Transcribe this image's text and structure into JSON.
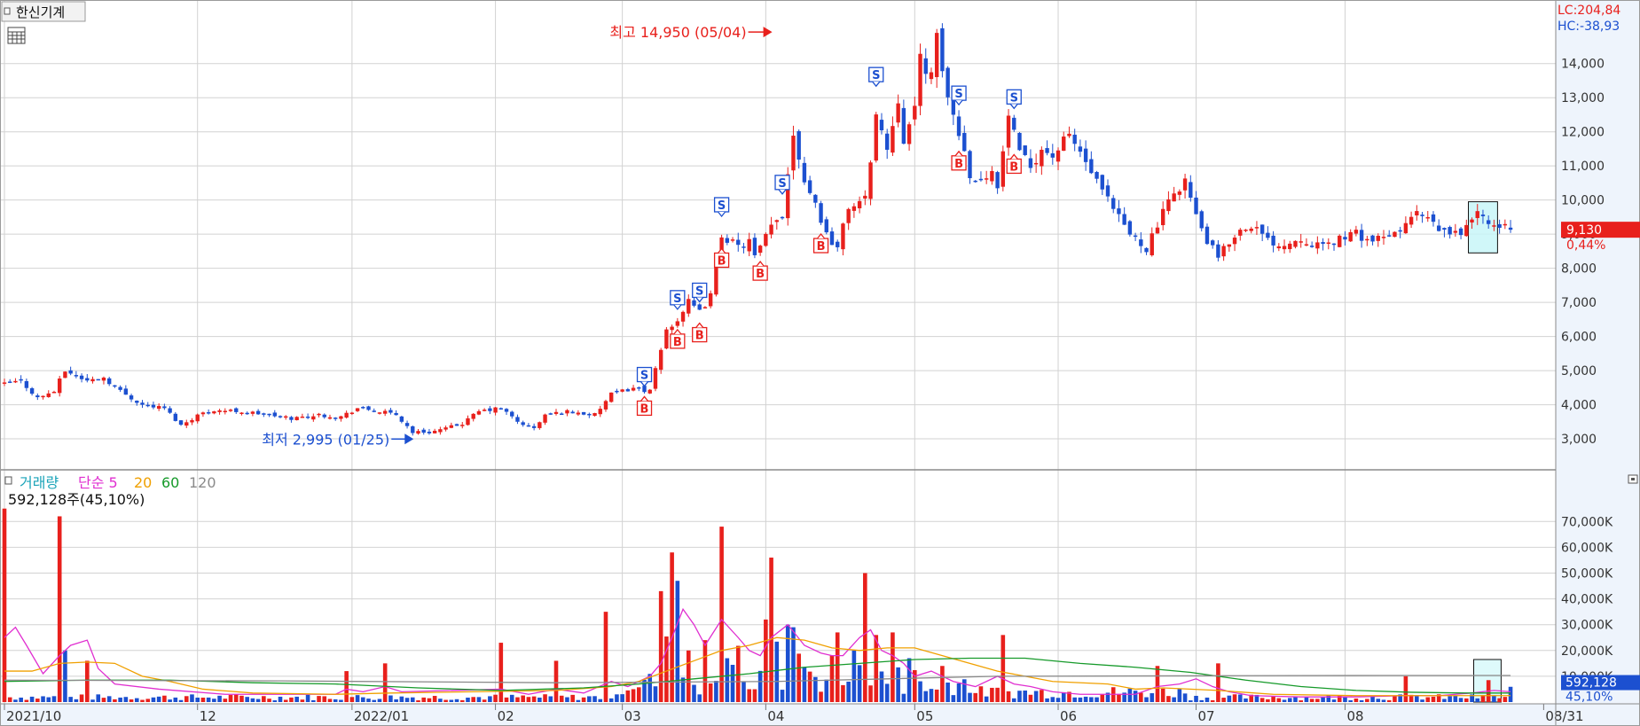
{
  "title": "한신기계",
  "header_right": {
    "lc": "LC:204,84",
    "hc": "HC:-38,93"
  },
  "current": {
    "price": 9130,
    "price_label": "9,130",
    "change_label": "0,44%",
    "volume_label": "592,128",
    "volume_pct_label": "45,10%"
  },
  "annotations": {
    "high_label": "최고 14,950 (05/04)",
    "high_value": 14950,
    "high_day": 139,
    "low_label": "최저 2,995 (01/25)",
    "low_value": 2995,
    "low_day": 74
  },
  "volume_panel": {
    "legend": [
      {
        "text": "거래량",
        "color": "#19a3b8"
      },
      {
        "text": "단순 5",
        "color": "#e02fd0"
      },
      {
        "text": "20",
        "color": "#f0a000"
      },
      {
        "text": "60",
        "color": "#169a2a"
      },
      {
        "text": "120",
        "color": "#8a8a8a"
      }
    ],
    "info": "592,128주(45,10%)"
  },
  "colors": {
    "up": "#e8201c",
    "down": "#1c50d0",
    "grid": "#d2d2d2",
    "axis_text": "#333333",
    "price_badge": "#e8201c",
    "vol_badge": "#1c50d0",
    "highlight": "#c8f6f8"
  },
  "chart_data": {
    "type": "candlestick",
    "x_axis_labels": [
      {
        "text": "2021/10",
        "day": 0
      },
      {
        "text": "12",
        "day": 35
      },
      {
        "text": "2022/01",
        "day": 63
      },
      {
        "text": "02",
        "day": 89
      },
      {
        "text": "03",
        "day": 112
      },
      {
        "text": "04",
        "day": 138
      },
      {
        "text": "05",
        "day": 165
      },
      {
        "text": "06",
        "day": 191
      },
      {
        "text": "07",
        "day": 216
      },
      {
        "text": "08",
        "day": 243
      },
      {
        "text": "08/31",
        "day": 279
      }
    ],
    "price_axis": {
      "min": 2300,
      "max": 15500,
      "ticks": [
        3000,
        4000,
        5000,
        6000,
        7000,
        8000,
        9000,
        10000,
        11000,
        12000,
        13000,
        14000
      ],
      "tick_labels": [
        "3,000",
        "4,000",
        "5,000",
        "6,000",
        "7,000",
        "8,000",
        "9,000",
        "10,000",
        "11,000",
        "12,000",
        "13,000",
        "14,000"
      ]
    },
    "volume_axis": {
      "min": 0,
      "max": 78000,
      "ticks": [
        10000,
        20000,
        30000,
        40000,
        50000,
        60000,
        70000
      ],
      "tick_labels": [
        "10,000K",
        "20,000K",
        "30,000K",
        "40,000K",
        "50,000K",
        "60,000K",
        "70,000K"
      ]
    },
    "price_anchors": [
      [
        0,
        4600
      ],
      [
        3,
        4700
      ],
      [
        6,
        4200
      ],
      [
        9,
        4400
      ],
      [
        11,
        5000
      ],
      [
        15,
        4700
      ],
      [
        18,
        4800
      ],
      [
        21,
        4400
      ],
      [
        25,
        4000
      ],
      [
        29,
        3900
      ],
      [
        32,
        3400
      ],
      [
        35,
        3700
      ],
      [
        38,
        3850
      ],
      [
        43,
        3800
      ],
      [
        48,
        3700
      ],
      [
        52,
        3600
      ],
      [
        57,
        3700
      ],
      [
        61,
        3650
      ],
      [
        64,
        3900
      ],
      [
        68,
        3800
      ],
      [
        71,
        3700
      ],
      [
        74,
        3200
      ],
      [
        77,
        3200
      ],
      [
        80,
        3300
      ],
      [
        83,
        3450
      ],
      [
        86,
        3800
      ],
      [
        90,
        3900
      ],
      [
        93,
        3500
      ],
      [
        96,
        3300
      ],
      [
        98,
        3700
      ],
      [
        102,
        3800
      ],
      [
        107,
        3700
      ],
      [
        110,
        4300
      ],
      [
        114,
        4500
      ],
      [
        117,
        4400
      ],
      [
        118,
        5000
      ],
      [
        120,
        6200
      ],
      [
        122,
        6500
      ],
      [
        124,
        7000
      ],
      [
        126,
        6700
      ],
      [
        128,
        7200
      ],
      [
        130,
        9000
      ],
      [
        133,
        8600
      ],
      [
        135,
        8800
      ],
      [
        136,
        8300
      ],
      [
        139,
        9200
      ],
      [
        141,
        9600
      ],
      [
        143,
        12000
      ],
      [
        145,
        10600
      ],
      [
        147,
        9900
      ],
      [
        149,
        9000
      ],
      [
        151,
        8600
      ],
      [
        153,
        9800
      ],
      [
        156,
        10000
      ],
      [
        158,
        12500
      ],
      [
        160,
        11500
      ],
      [
        162,
        13000
      ],
      [
        163,
        11800
      ],
      [
        165,
        12600
      ],
      [
        166,
        14200
      ],
      [
        168,
        13600
      ],
      [
        169,
        14700
      ],
      [
        171,
        13000
      ],
      [
        173,
        12000
      ],
      [
        175,
        10800
      ],
      [
        177,
        10500
      ],
      [
        179,
        11000
      ],
      [
        180,
        10300
      ],
      [
        182,
        12500
      ],
      [
        184,
        11300
      ],
      [
        186,
        11000
      ],
      [
        188,
        11500
      ],
      [
        190,
        11300
      ],
      [
        193,
        11900
      ],
      [
        195,
        11400
      ],
      [
        198,
        10500
      ],
      [
        201,
        9700
      ],
      [
        204,
        9000
      ],
      [
        207,
        8600
      ],
      [
        210,
        9600
      ],
      [
        212,
        10200
      ],
      [
        214,
        10600
      ],
      [
        216,
        9500
      ],
      [
        218,
        8800
      ],
      [
        220,
        8300
      ],
      [
        223,
        9000
      ],
      [
        226,
        9300
      ],
      [
        229,
        8800
      ],
      [
        232,
        8700
      ],
      [
        235,
        8900
      ],
      [
        239,
        8600
      ],
      [
        242,
        8900
      ],
      [
        245,
        9000
      ],
      [
        248,
        8800
      ],
      [
        251,
        8900
      ],
      [
        254,
        9300
      ],
      [
        256,
        9600
      ],
      [
        258,
        9400
      ],
      [
        260,
        9100
      ],
      [
        263,
        9000
      ],
      [
        265,
        9200
      ],
      [
        267,
        9700
      ],
      [
        269,
        9200
      ],
      [
        271,
        9300
      ],
      [
        273,
        9130
      ]
    ],
    "volume_spikes": [
      {
        "day": 0,
        "value": 75000,
        "dir": "up"
      },
      {
        "day": 10,
        "value": 72000,
        "dir": "up"
      },
      {
        "day": 11,
        "value": 20000,
        "dir": "down"
      },
      {
        "day": 15,
        "value": 16000,
        "dir": "up"
      },
      {
        "day": 62,
        "value": 12000,
        "dir": "up"
      },
      {
        "day": 69,
        "value": 15000,
        "dir": "up"
      },
      {
        "day": 90,
        "value": 23000,
        "dir": "up"
      },
      {
        "day": 100,
        "value": 16000,
        "dir": "up"
      },
      {
        "day": 109,
        "value": 35000,
        "dir": "up"
      },
      {
        "day": 119,
        "value": 43000,
        "dir": "up"
      },
      {
        "day": 121,
        "value": 58000,
        "dir": "up"
      },
      {
        "day": 122,
        "value": 47000,
        "dir": "down"
      },
      {
        "day": 124,
        "value": 20000,
        "dir": "up"
      },
      {
        "day": 127,
        "value": 24000,
        "dir": "up"
      },
      {
        "day": 130,
        "value": 68000,
        "dir": "up"
      },
      {
        "day": 131,
        "value": 17000,
        "dir": "down"
      },
      {
        "day": 138,
        "value": 32000,
        "dir": "up"
      },
      {
        "day": 139,
        "value": 56000,
        "dir": "up"
      },
      {
        "day": 142,
        "value": 30000,
        "dir": "down"
      },
      {
        "day": 143,
        "value": 29000,
        "dir": "down"
      },
      {
        "day": 151,
        "value": 27000,
        "dir": "up"
      },
      {
        "day": 154,
        "value": 20000,
        "dir": "down"
      },
      {
        "day": 156,
        "value": 50000,
        "dir": "up"
      },
      {
        "day": 158,
        "value": 26000,
        "dir": "up"
      },
      {
        "day": 161,
        "value": 27000,
        "dir": "up"
      },
      {
        "day": 164,
        "value": 17000,
        "dir": "down"
      },
      {
        "day": 170,
        "value": 14000,
        "dir": "up"
      },
      {
        "day": 181,
        "value": 26000,
        "dir": "up"
      },
      {
        "day": 209,
        "value": 14000,
        "dir": "up"
      },
      {
        "day": 220,
        "value": 15000,
        "dir": "up"
      },
      {
        "day": 254,
        "value": 10000,
        "dir": "up"
      },
      {
        "day": 269,
        "value": 8500,
        "dir": "up"
      },
      {
        "day": 273,
        "value": 5921,
        "dir": "down"
      }
    ],
    "ma_lines": [
      {
        "name": "단순 5",
        "color": "#e02fd0",
        "points": [
          [
            0,
            25000
          ],
          [
            2,
            29000
          ],
          [
            4,
            22000
          ],
          [
            7,
            11000
          ],
          [
            10,
            18000
          ],
          [
            12,
            22000
          ],
          [
            15,
            24000
          ],
          [
            17,
            13000
          ],
          [
            20,
            7000
          ],
          [
            28,
            5000
          ],
          [
            40,
            3000
          ],
          [
            60,
            3000
          ],
          [
            62,
            5000
          ],
          [
            65,
            4000
          ],
          [
            69,
            6000
          ],
          [
            72,
            4000
          ],
          [
            90,
            5000
          ],
          [
            95,
            3000
          ],
          [
            100,
            5000
          ],
          [
            105,
            3500
          ],
          [
            110,
            8000
          ],
          [
            113,
            6000
          ],
          [
            117,
            10000
          ],
          [
            119,
            15000
          ],
          [
            121,
            25000
          ],
          [
            123,
            36000
          ],
          [
            125,
            30000
          ],
          [
            127,
            22000
          ],
          [
            130,
            32000
          ],
          [
            133,
            25000
          ],
          [
            135,
            20000
          ],
          [
            137,
            18000
          ],
          [
            139,
            25000
          ],
          [
            142,
            30000
          ],
          [
            145,
            22000
          ],
          [
            148,
            19000
          ],
          [
            150,
            18000
          ],
          [
            152,
            18000
          ],
          [
            155,
            25000
          ],
          [
            157,
            28000
          ],
          [
            159,
            20000
          ],
          [
            161,
            18000
          ],
          [
            163,
            15000
          ],
          [
            165,
            10000
          ],
          [
            168,
            12000
          ],
          [
            172,
            8000
          ],
          [
            176,
            6000
          ],
          [
            180,
            10000
          ],
          [
            183,
            7000
          ],
          [
            186,
            6000
          ],
          [
            190,
            4000
          ],
          [
            195,
            3000
          ],
          [
            200,
            3000
          ],
          [
            205,
            3000
          ],
          [
            209,
            6000
          ],
          [
            213,
            7000
          ],
          [
            216,
            9000
          ],
          [
            219,
            6000
          ],
          [
            222,
            4000
          ],
          [
            226,
            2500
          ],
          [
            235,
            2000
          ],
          [
            245,
            2000
          ],
          [
            254,
            2500
          ],
          [
            260,
            2500
          ],
          [
            266,
            3500
          ],
          [
            270,
            4500
          ],
          [
            273,
            4000
          ]
        ]
      },
      {
        "name": "20",
        "color": "#f0a000",
        "points": [
          [
            0,
            12000
          ],
          [
            5,
            12000
          ],
          [
            10,
            15000
          ],
          [
            15,
            15500
          ],
          [
            20,
            15000
          ],
          [
            25,
            10000
          ],
          [
            30,
            8000
          ],
          [
            36,
            5000
          ],
          [
            45,
            3500
          ],
          [
            60,
            3000
          ],
          [
            70,
            3500
          ],
          [
            85,
            4000
          ],
          [
            100,
            4500
          ],
          [
            110,
            6000
          ],
          [
            115,
            8000
          ],
          [
            120,
            12000
          ],
          [
            125,
            16000
          ],
          [
            130,
            20000
          ],
          [
            135,
            22000
          ],
          [
            140,
            25000
          ],
          [
            145,
            24000
          ],
          [
            150,
            21000
          ],
          [
            155,
            20000
          ],
          [
            160,
            21000
          ],
          [
            165,
            21000
          ],
          [
            170,
            18000
          ],
          [
            175,
            15000
          ],
          [
            180,
            12000
          ],
          [
            185,
            10000
          ],
          [
            190,
            8000
          ],
          [
            200,
            7000
          ],
          [
            205,
            5000
          ],
          [
            210,
            5500
          ],
          [
            220,
            4500
          ],
          [
            230,
            3000
          ],
          [
            245,
            2500
          ],
          [
            260,
            2500
          ],
          [
            273,
            2500
          ]
        ]
      },
      {
        "name": "60",
        "color": "#169a2a",
        "points": [
          [
            0,
            8000
          ],
          [
            15,
            8500
          ],
          [
            30,
            8500
          ],
          [
            45,
            7500
          ],
          [
            60,
            7000
          ],
          [
            75,
            5500
          ],
          [
            90,
            4500
          ],
          [
            105,
            5500
          ],
          [
            115,
            7000
          ],
          [
            125,
            9000
          ],
          [
            135,
            11000
          ],
          [
            145,
            13500
          ],
          [
            155,
            15000
          ],
          [
            165,
            16500
          ],
          [
            175,
            17000
          ],
          [
            185,
            17000
          ],
          [
            195,
            15000
          ],
          [
            205,
            13500
          ],
          [
            215,
            11500
          ],
          [
            225,
            8500
          ],
          [
            235,
            6000
          ],
          [
            245,
            4500
          ],
          [
            255,
            3800
          ],
          [
            265,
            3500
          ],
          [
            273,
            3500
          ]
        ]
      },
      {
        "name": "120",
        "color": "#8a8a8a",
        "points": [
          [
            0,
            8500
          ],
          [
            50,
            8200
          ],
          [
            100,
            7500
          ],
          [
            140,
            8000
          ],
          [
            180,
            10000
          ],
          [
            220,
            10200
          ],
          [
            250,
            10300
          ],
          [
            273,
            10300
          ]
        ]
      }
    ],
    "signals": [
      {
        "day": 116,
        "type": "S"
      },
      {
        "day": 116,
        "type": "B"
      },
      {
        "day": 122,
        "type": "S"
      },
      {
        "day": 122,
        "type": "B"
      },
      {
        "day": 126,
        "type": "S"
      },
      {
        "day": 126,
        "type": "B"
      },
      {
        "day": 130,
        "type": "S"
      },
      {
        "day": 130,
        "type": "B"
      },
      {
        "day": 137,
        "type": "B"
      },
      {
        "day": 141,
        "type": "S"
      },
      {
        "day": 148,
        "type": "B"
      },
      {
        "day": 158,
        "type": "S"
      },
      {
        "day": 173,
        "type": "S"
      },
      {
        "day": 173,
        "type": "B"
      },
      {
        "day": 183,
        "type": "S"
      },
      {
        "day": 183,
        "type": "B"
      }
    ],
    "highlight_range": {
      "from_day": 266,
      "to_day": 270,
      "price_from": 8450,
      "price_to": 9950
    }
  }
}
